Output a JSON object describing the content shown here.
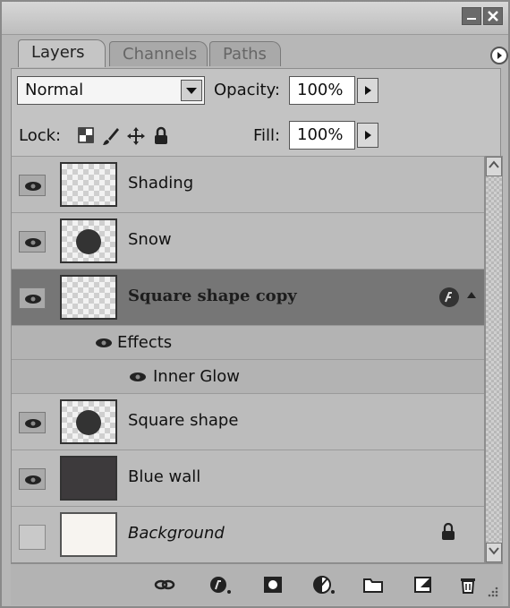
{
  "tabs": [
    {
      "label": "Layers",
      "active": true
    },
    {
      "label": "Channels",
      "active": false
    },
    {
      "label": "Paths",
      "active": false
    }
  ],
  "blend_mode": "Normal",
  "opacity": {
    "label": "Opacity:",
    "value": "100%"
  },
  "lock": {
    "label": "Lock:",
    "icons": [
      "transparent-pixels-lock-icon",
      "brush-lock-icon",
      "move-lock-icon",
      "padlock-icon"
    ]
  },
  "fill": {
    "label": "Fill:",
    "value": "100%"
  },
  "layers": [
    {
      "name": "Shading",
      "visible": true,
      "thumb": "checker"
    },
    {
      "name": "Snow",
      "visible": true,
      "thumb": "checker-dot"
    },
    {
      "name": "Square shape copy",
      "visible": true,
      "thumb": "checker",
      "selected": true,
      "has_effects": true
    },
    {
      "name": "Square shape",
      "visible": true,
      "thumb": "checker-dot"
    },
    {
      "name": "Blue wall",
      "visible": true,
      "thumb": "solid-dark"
    },
    {
      "name": "Background",
      "visible": false,
      "thumb": "solid-white",
      "locked": true
    }
  ],
  "effects": {
    "label": "Effects",
    "items": [
      "Inner Glow"
    ]
  },
  "bottom_icons": [
    "link-layers-icon",
    "layer-style-icon",
    "layer-mask-icon",
    "adjustment-layer-icon",
    "new-group-icon",
    "new-layer-icon",
    "delete-layer-icon"
  ],
  "colors": {
    "panel": "#b7b7b7",
    "selected_row": "#767676",
    "text": "#111111"
  }
}
